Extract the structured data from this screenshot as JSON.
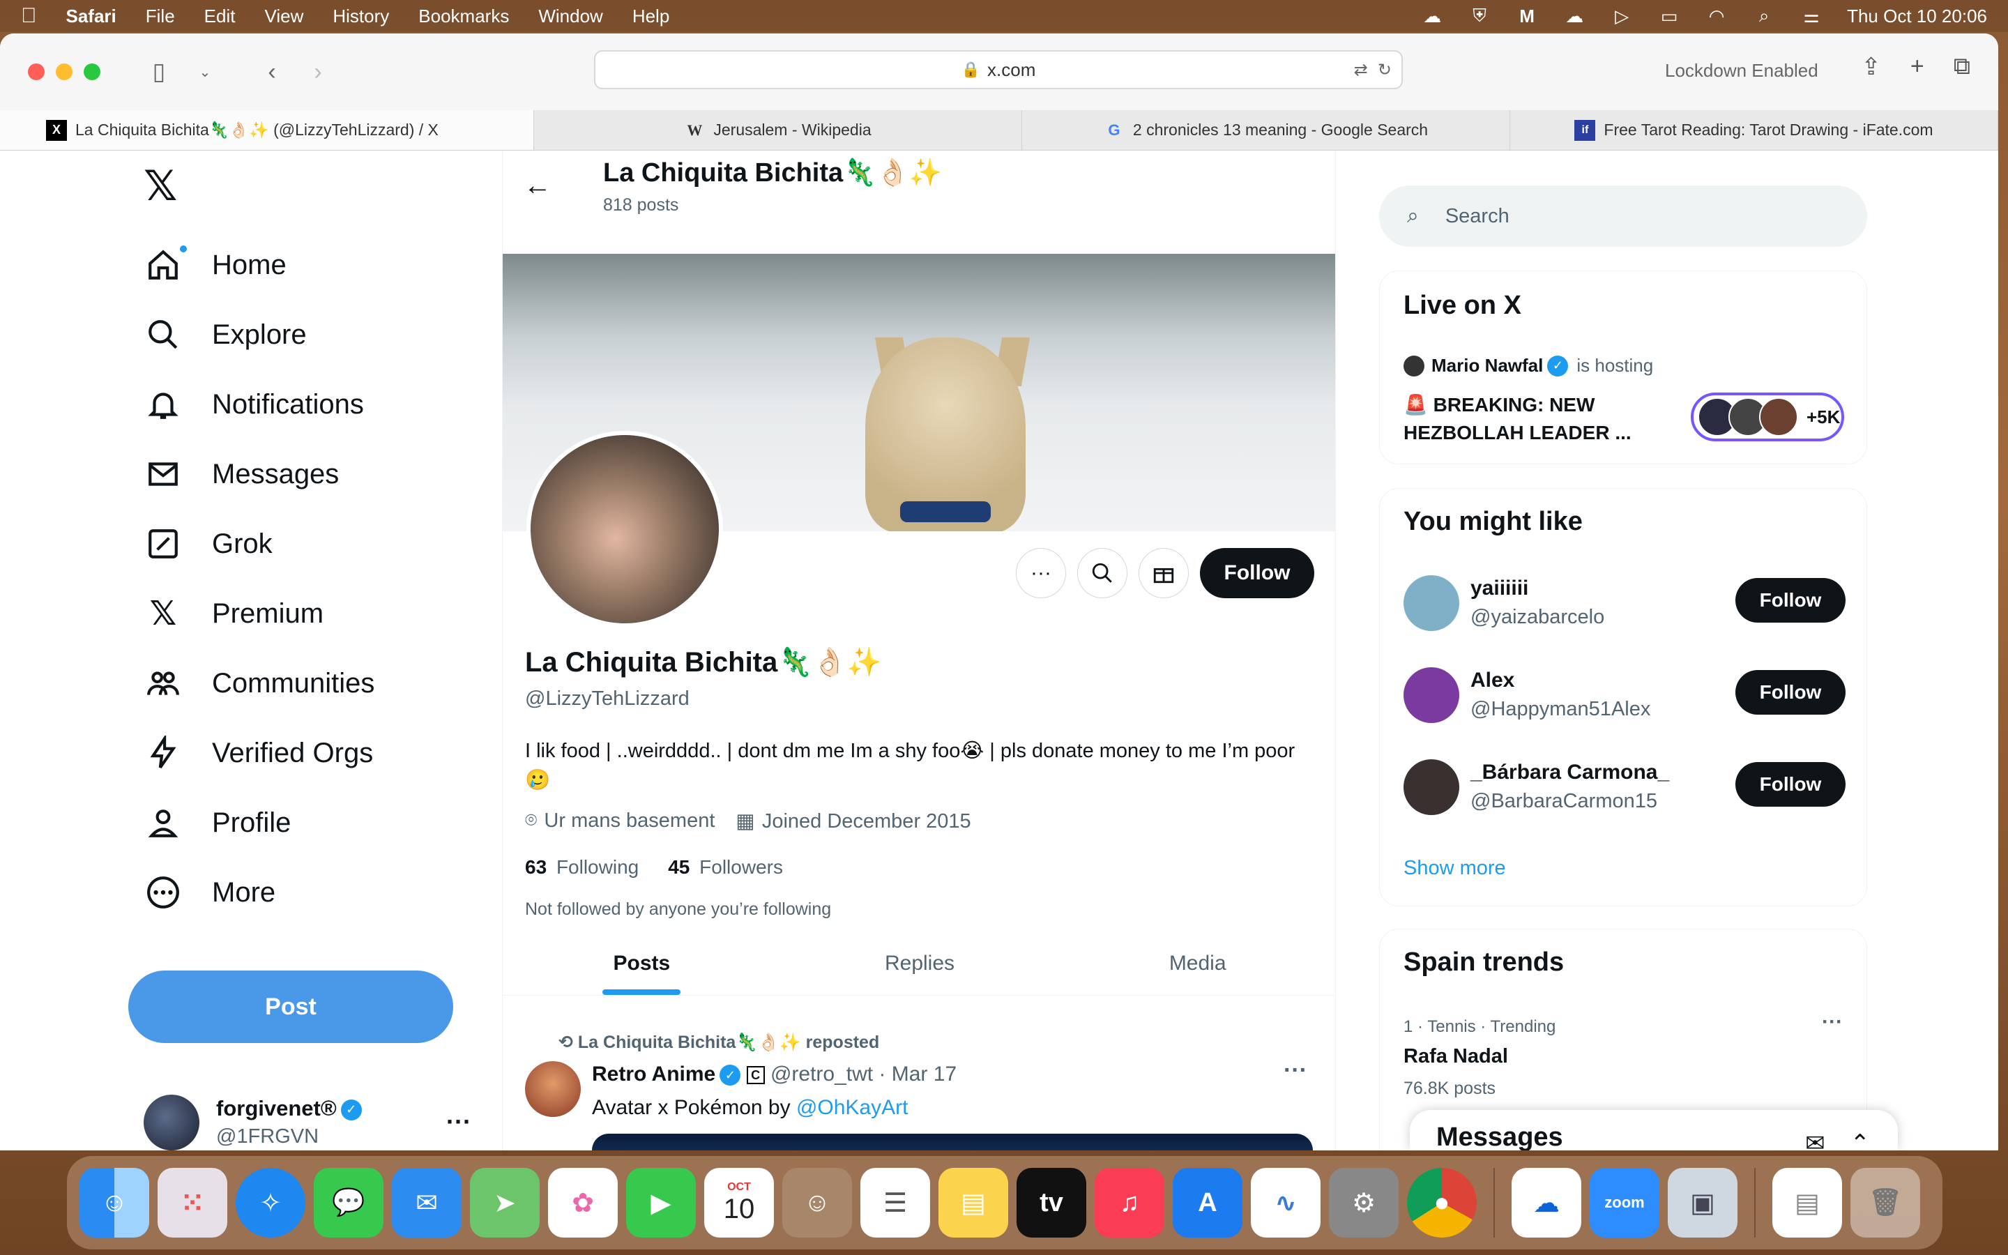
{
  "menubar": {
    "app": "Safari",
    "items": [
      "File",
      "Edit",
      "View",
      "History",
      "Bookmarks",
      "Window",
      "Help"
    ],
    "datetime": "Thu Oct 10  20:06"
  },
  "browser": {
    "url": "x.com",
    "lockdown": "Lockdown Enabled",
    "tabs": [
      {
        "label": "La Chiquita Bichita🦎👌🏻✨ (@LizzyTehLizzard) / X",
        "icon": "X"
      },
      {
        "label": "Jerusalem - Wikipedia",
        "icon": "W"
      },
      {
        "label": "2 chronicles 13 meaning - Google Search",
        "icon": "G"
      },
      {
        "label": "Free Tarot Reading: Tarot Drawing - iFate.com",
        "icon": "if"
      }
    ]
  },
  "nav": {
    "items": [
      "Home",
      "Explore",
      "Notifications",
      "Messages",
      "Grok",
      "Premium",
      "Communities",
      "Verified Orgs",
      "Profile",
      "More"
    ],
    "post_label": "Post",
    "account_name": "forgivenet®",
    "account_handle": "@1FRGVN"
  },
  "profile": {
    "header_name": "La Chiquita Bichita🦎👌🏻✨",
    "post_count": "818 posts",
    "name": "La Chiquita Bichita🦎👌🏻✨",
    "handle": "@LizzyTehLizzard",
    "bio": "I lik food | ..weirdddd.. | dont dm me Im a shy foo😭 | pls donate money to me I’m poor🥲",
    "location": "Ur mans basement",
    "joined": "Joined December 2015",
    "following_count": "63",
    "following_label": "Following",
    "followers_count": "45",
    "followers_label": "Followers",
    "not_followed": "Not followed by anyone you’re following",
    "follow_label": "Follow",
    "tabs": [
      "Posts",
      "Replies",
      "Media"
    ]
  },
  "post": {
    "repost_text": "La Chiquita Bichita🦎👌🏻✨ reposted",
    "author": "Retro Anime",
    "handle_date": "@retro_twt · Mar 17",
    "text_prefix": "Avatar x Pokémon by ",
    "mention": "@OhKayArt"
  },
  "sidebar": {
    "search_placeholder": "Search",
    "live": {
      "title": "Live on X",
      "host": "Mario Nawfal",
      "hosting": "is hosting",
      "headline": "🚨 BREAKING: NEW HEZBOLLAH LEADER ...",
      "listeners": "+5K"
    },
    "wtf": {
      "title": "You might like",
      "users": [
        {
          "name": "yaiiiiii",
          "handle": "@yaizabarcelo",
          "color": "#7fb0c8"
        },
        {
          "name": "Alex",
          "handle": "@Happyman51Alex",
          "color": "#7a3aa0"
        },
        {
          "name": "_Bárbara Carmona_",
          "handle": "@BarbaraCarmon15",
          "color": "#3a3030"
        }
      ],
      "follow_label": "Follow",
      "show_more": "Show more"
    },
    "trends": {
      "title": "Spain trends",
      "meta": "1 · Tennis · Trending",
      "name": "Rafa Nadal",
      "posts": "76.8K posts"
    },
    "messages_title": "Messages"
  },
  "dock": {
    "calendar_month": "OCT",
    "calendar_day": "10",
    "tv_label": "tv",
    "zoom_label": "zoom"
  }
}
